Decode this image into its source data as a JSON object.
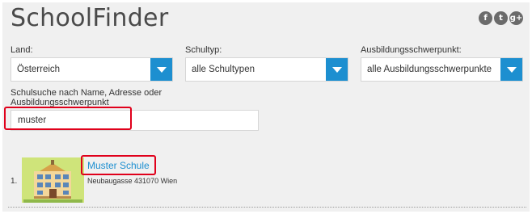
{
  "app": {
    "title": "SchoolFinder"
  },
  "social": {
    "icons": [
      "facebook-icon",
      "twitter-icon",
      "google-plus-icon"
    ]
  },
  "filters": {
    "land": {
      "label": "Land:",
      "value": "Österreich"
    },
    "schultyp": {
      "label": "Schultyp:",
      "value": "alle Schultypen"
    },
    "schwerpunkt": {
      "label": "Ausbildungsschwerpunkt:",
      "value": "alle Ausbildungsschwerpunkte"
    }
  },
  "search": {
    "label": "Schulsuche nach Name, Adresse oder Ausbildungsschwerpunkt",
    "value": "muster"
  },
  "results": [
    {
      "index": "1.",
      "name": "Muster Schule",
      "address": "Neubaugasse 431070 Wien"
    }
  ],
  "colors": {
    "accent": "#1d8fd0",
    "highlight": "#e0001b",
    "panel": "#f0f0f0",
    "thumb": "#cfe47a"
  }
}
